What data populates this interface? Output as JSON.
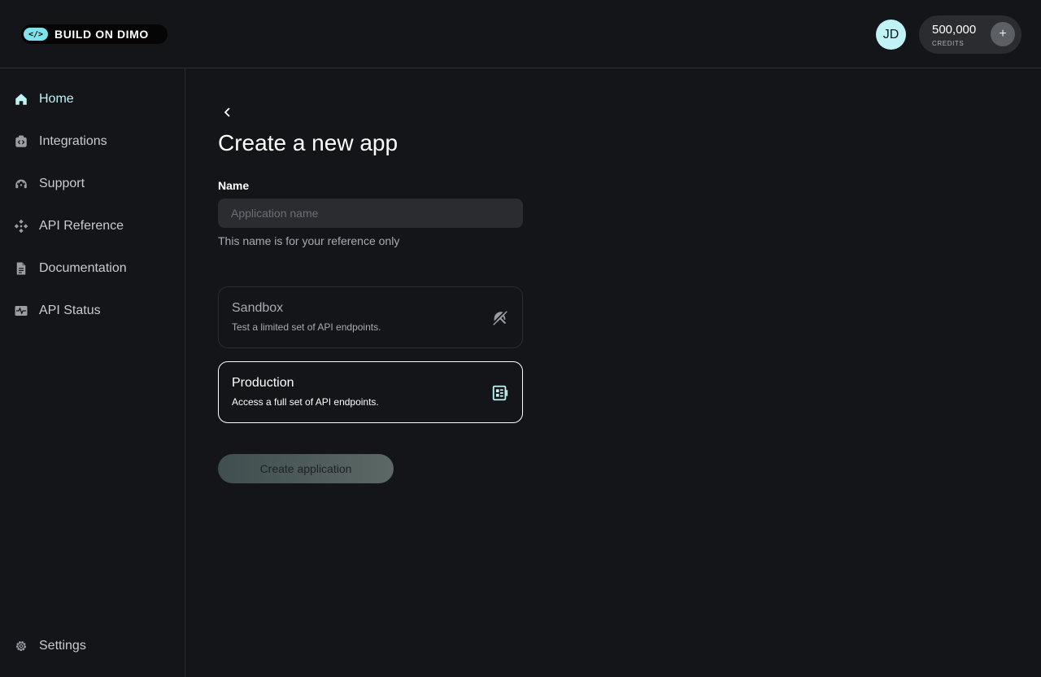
{
  "header": {
    "logo": {
      "mark": "</>",
      "text": "BUILD ON DIMO"
    },
    "avatar_initials": "JD",
    "credits": {
      "value": "500,000",
      "label": "CREDITS",
      "add_symbol": "+"
    }
  },
  "sidebar": {
    "items": [
      {
        "label": "Home",
        "icon": "home-icon",
        "active": true
      },
      {
        "label": "Integrations",
        "icon": "integrations-icon"
      },
      {
        "label": "Support",
        "icon": "headset-icon"
      },
      {
        "label": "API Reference",
        "icon": "api-reference-icon"
      },
      {
        "label": "Documentation",
        "icon": "document-icon"
      },
      {
        "label": "API Status",
        "icon": "pulse-icon"
      }
    ],
    "settings_label": "Settings"
  },
  "main": {
    "title": "Create a new app",
    "name_field": {
      "label": "Name",
      "placeholder": "Application name",
      "value": "",
      "help": "This name is for your reference only"
    },
    "environments": [
      {
        "title": "Sandbox",
        "description": "Test a limited set of API endpoints.",
        "icon": "umbrella-off-icon",
        "selected": false
      },
      {
        "title": "Production",
        "description": "Access a full set of API endpoints.",
        "icon": "dashboard-icon",
        "selected": true
      }
    ],
    "submit_label": "Create application"
  },
  "colors": {
    "background": "#141519",
    "accent": "#bff3f5",
    "logo_accent": "#7fe3ee",
    "border": "#2a2c30"
  }
}
